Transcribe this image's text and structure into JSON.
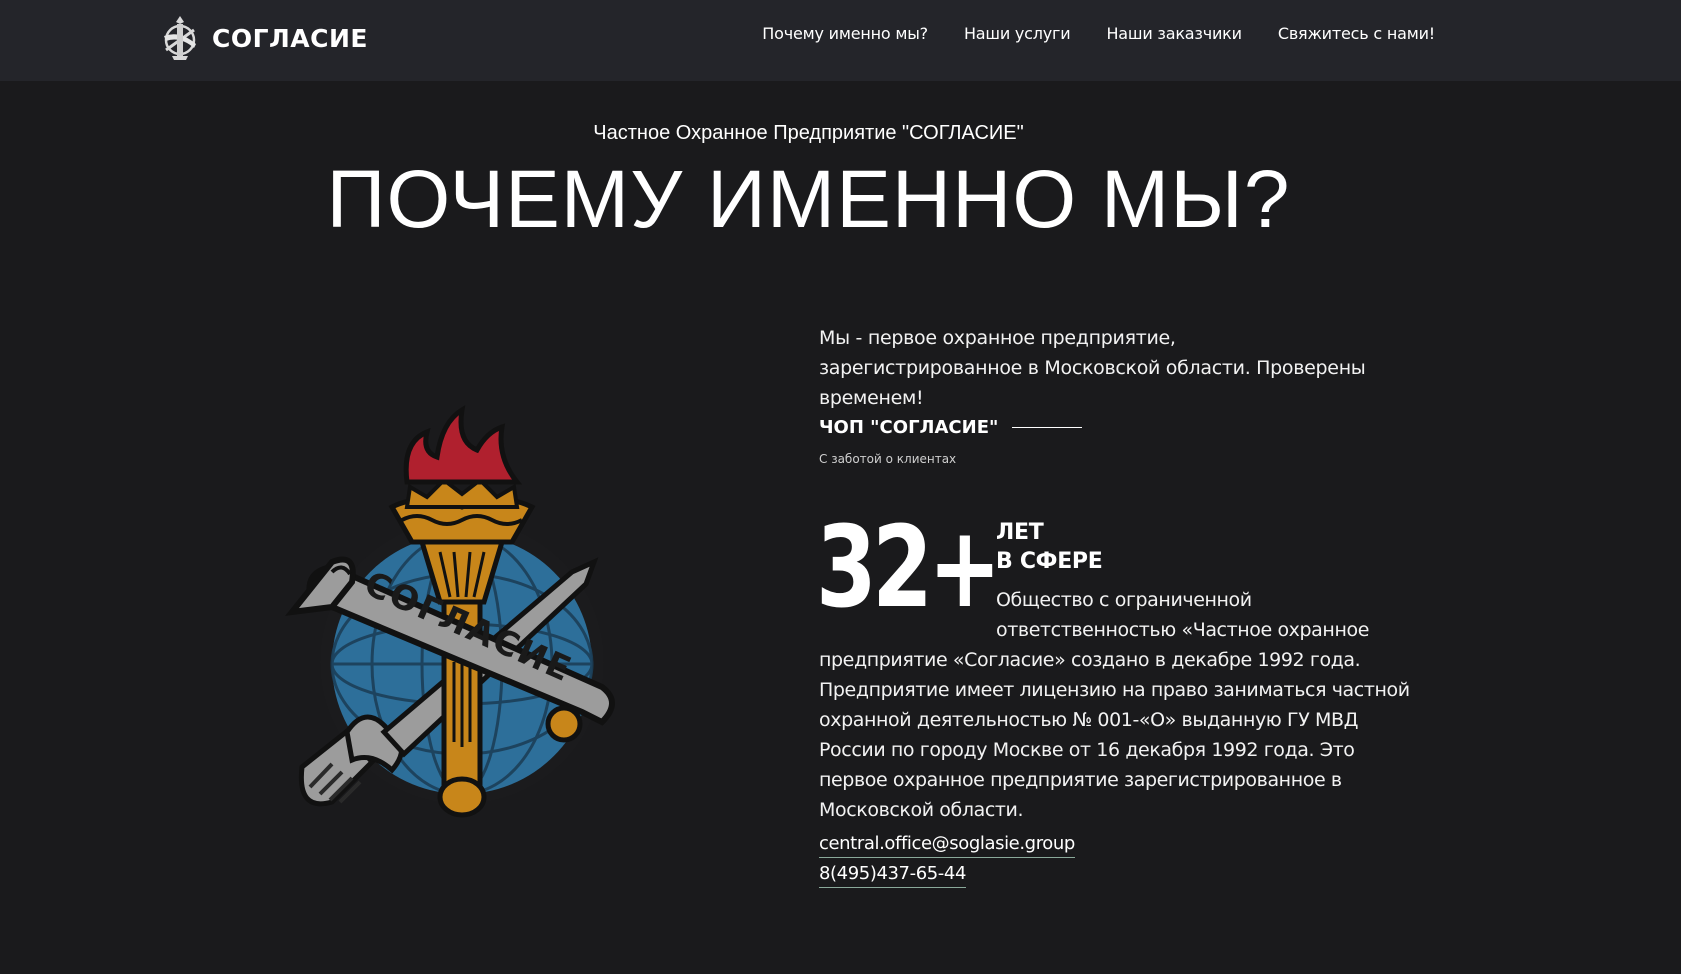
{
  "header": {
    "brand": "СОГЛАСИЕ",
    "nav": [
      {
        "label": "Почему именно мы?"
      },
      {
        "label": "Наши услуги"
      },
      {
        "label": "Наши заказчики"
      },
      {
        "label": "Свяжитесь с нами!"
      }
    ]
  },
  "hero": {
    "eyebrow": "Частное Охранное Предприятие \"СОГЛАСИЕ\"",
    "title": "ПОЧЕМУ ИМЕННО МЫ?"
  },
  "emblem": {
    "ribbon_text": "СОГЛАСИЕ",
    "colors": {
      "flame": "#b0202e",
      "gold": "#c8861a",
      "globe": "#2d6f9a",
      "ribbon": "#9c9c9c"
    }
  },
  "about": {
    "intro": "Мы - первое охранное предприятие, зарегистрированное в Московской области. Проверены временем!",
    "signature_title": "ЧОП \"СОГЛАСИЕ\"",
    "signature_sub": "С заботой о клиентах",
    "years_number": "32+",
    "years_line1": "ЛЕТ",
    "years_line2": "В СФЕРЕ",
    "description": "Общество с ограниченной ответственностью «Частное охранное предприятие «Согласие» создано в декабре 1992 года. Предприятие имеет лицензию на право заниматься частной охранной деятельностью № 001-«О» выданную ГУ МВД России по городу Москве от 16 декабря 1992 года. Это первое охранное предприятие зарегистрированное в Московской области.",
    "email": "central.office@soglasie.group",
    "phone": "8(495)437-65-44"
  },
  "colors": {
    "page_bg": "#1a1a1c",
    "header_bg": "#24252a",
    "text": "#ffffff",
    "link_underline": "#8aa99a"
  }
}
